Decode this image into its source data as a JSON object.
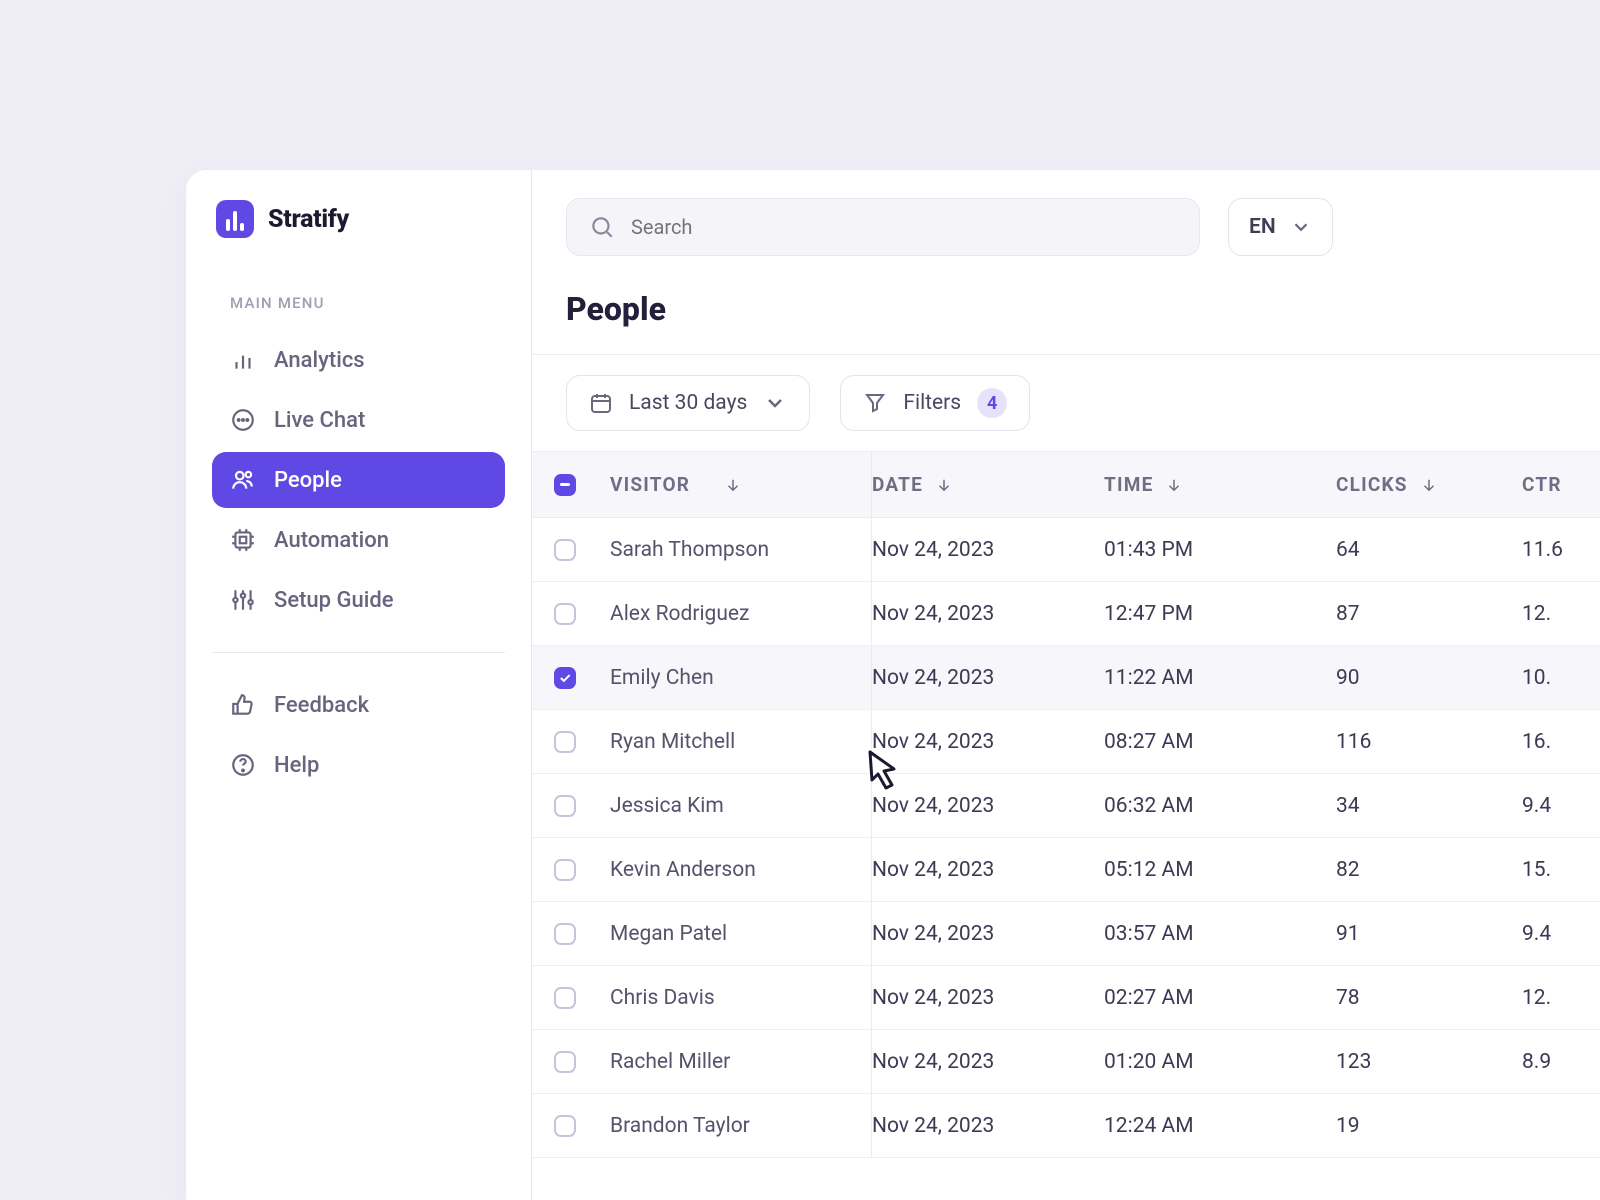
{
  "brand": {
    "name": "Stratify"
  },
  "sidebar": {
    "menu_label": "MAIN MENU",
    "items": [
      {
        "label": "Analytics"
      },
      {
        "label": "Live Chat"
      },
      {
        "label": "People"
      },
      {
        "label": "Automation"
      },
      {
        "label": "Setup Guide"
      }
    ],
    "footer": [
      {
        "label": "Feedback"
      },
      {
        "label": "Help"
      }
    ]
  },
  "topbar": {
    "search_placeholder": "Search",
    "language": "EN"
  },
  "page": {
    "title": "People"
  },
  "toolbar": {
    "date_range": "Last 30 days",
    "filters_label": "Filters",
    "filters_count": "4"
  },
  "table": {
    "columns": [
      "VISITOR",
      "DATE",
      "TIME",
      "CLICKS",
      "CTR"
    ],
    "rows": [
      {
        "visitor": "Sarah Thompson",
        "date": "Nov 24, 2023",
        "time": "01:43 PM",
        "clicks": "64",
        "ctr": "11.6",
        "checked": false
      },
      {
        "visitor": "Alex Rodriguez",
        "date": "Nov 24, 2023",
        "time": "12:47 PM",
        "clicks": "87",
        "ctr": "12.",
        "checked": false
      },
      {
        "visitor": "Emily Chen",
        "date": "Nov 24, 2023",
        "time": "11:22 AM",
        "clicks": "90",
        "ctr": "10.",
        "checked": true
      },
      {
        "visitor": "Ryan Mitchell",
        "date": "Nov 24, 2023",
        "time": "08:27 AM",
        "clicks": "116",
        "ctr": "16.",
        "checked": false
      },
      {
        "visitor": "Jessica Kim",
        "date": "Nov 24, 2023",
        "time": "06:32 AM",
        "clicks": "34",
        "ctr": "9.4",
        "checked": false
      },
      {
        "visitor": "Kevin Anderson",
        "date": "Nov 24, 2023",
        "time": "05:12 AM",
        "clicks": "82",
        "ctr": "15.",
        "checked": false
      },
      {
        "visitor": "Megan Patel",
        "date": "Nov 24, 2023",
        "time": "03:57 AM",
        "clicks": "91",
        "ctr": "9.4",
        "checked": false
      },
      {
        "visitor": "Chris Davis",
        "date": "Nov 24, 2023",
        "time": "02:27 AM",
        "clicks": "78",
        "ctr": "12.",
        "checked": false
      },
      {
        "visitor": "Rachel Miller",
        "date": "Nov 24, 2023",
        "time": "01:20 AM",
        "clicks": "123",
        "ctr": "8.9",
        "checked": false
      },
      {
        "visitor": "Brandon Taylor",
        "date": "Nov 24, 2023",
        "time": "12:24 AM",
        "clicks": "19",
        "ctr": "",
        "checked": false
      }
    ]
  }
}
